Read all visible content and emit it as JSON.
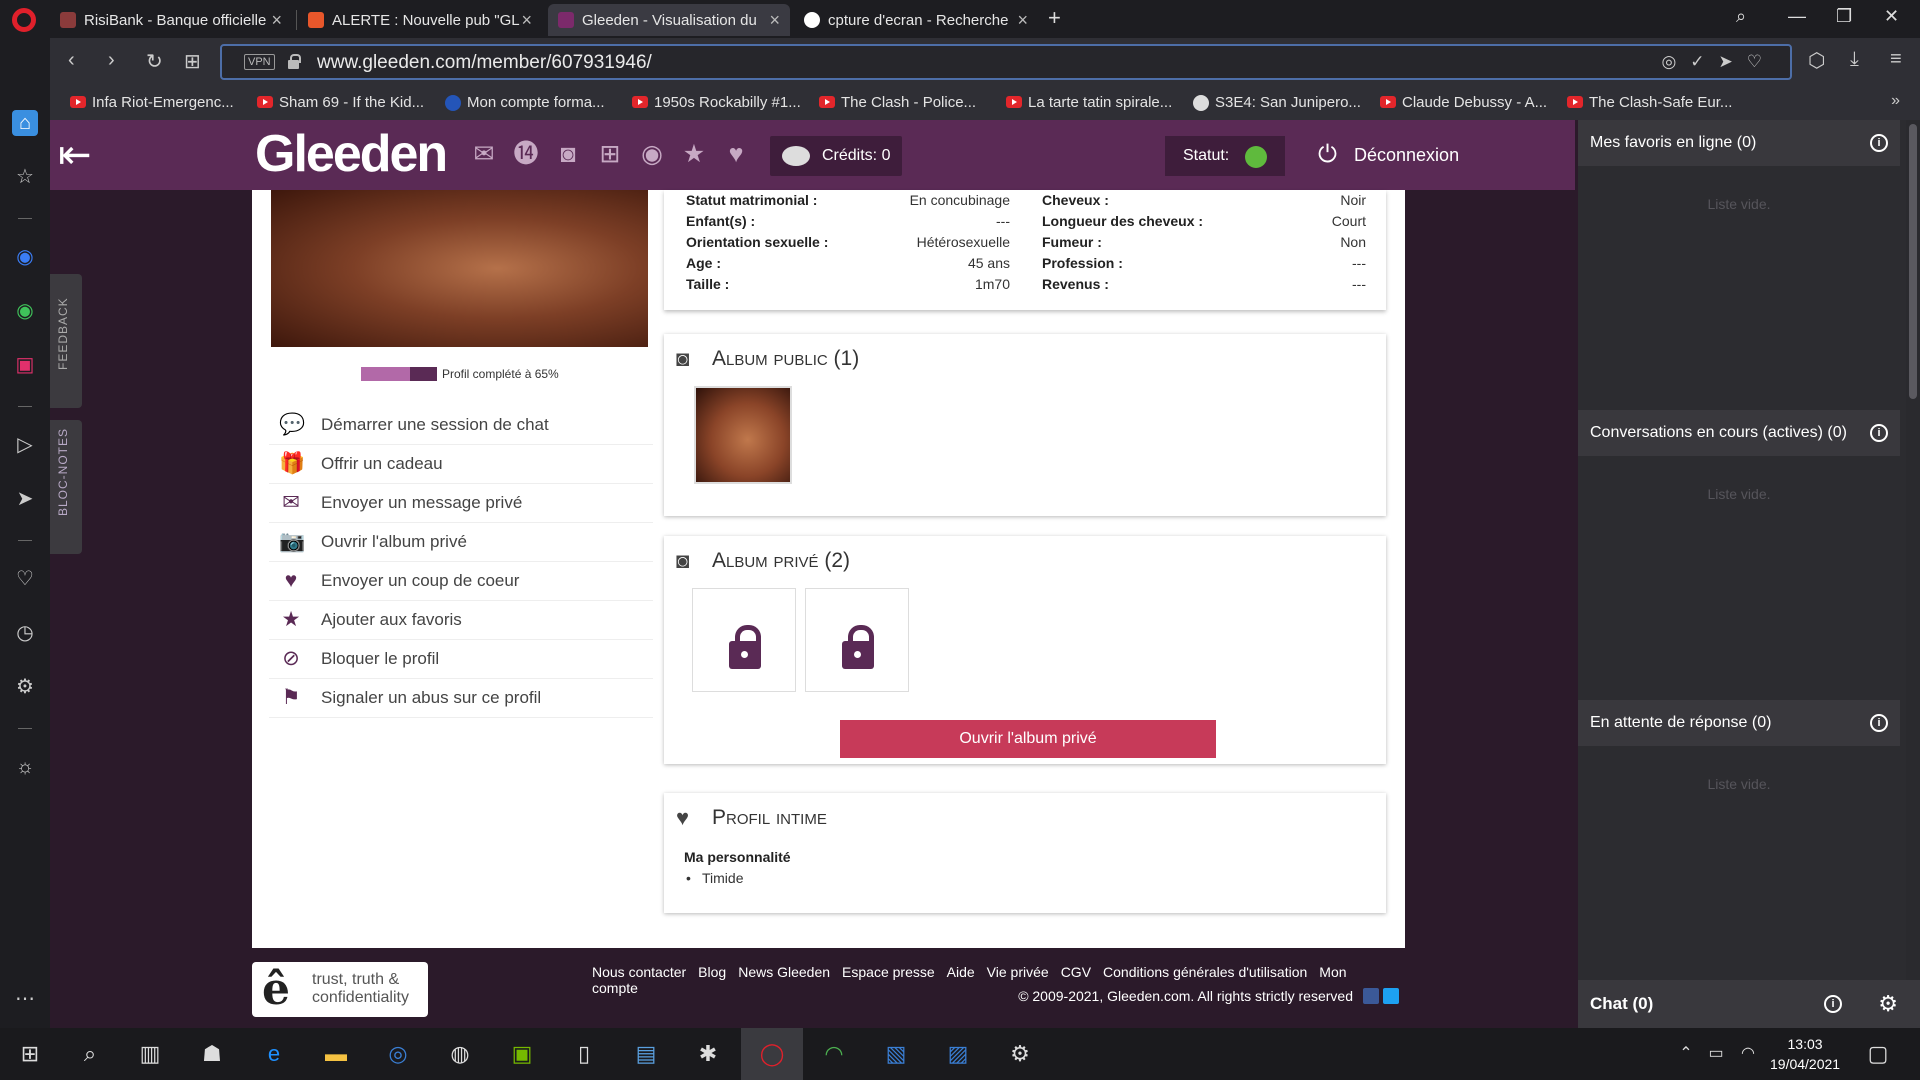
{
  "browser": {
    "tabs": [
      {
        "title": "RisiBank - Banque officielle",
        "color": "#8a3b3b"
      },
      {
        "title": "ALERTE : Nouvelle pub \"GL",
        "color": "#e8572b"
      },
      {
        "title": "Gleeden - Visualisation du",
        "color": "#7c2a6b",
        "active": true
      },
      {
        "title": "cpture d'ecran - Recherche",
        "color": "#ffffff"
      }
    ],
    "new_tab": "+",
    "url": "www.gleeden.com/member/607931946/",
    "vpn": "VPN",
    "bookmarks": [
      {
        "label": "Infa Riot-Emergenc...",
        "type": "youtube"
      },
      {
        "label": "Sham 69 - If the Kid...",
        "type": "youtube"
      },
      {
        "label": "Mon compte forma...",
        "type": "generic"
      },
      {
        "label": "1950s Rockabilly #1...",
        "type": "youtube"
      },
      {
        "label": "The Clash - Police...",
        "type": "youtube"
      },
      {
        "label": "La tarte tatin spirale...",
        "type": "youtube"
      },
      {
        "label": "S3E4: San Junipero...",
        "type": "generic"
      },
      {
        "label": "Claude Debussy - A...",
        "type": "youtube"
      },
      {
        "label": "The Clash-Safe Eur...",
        "type": "youtube"
      }
    ]
  },
  "side_tabs": {
    "feedback": "FEEDBACK",
    "notes": "BLOC-NOTES"
  },
  "header": {
    "brand": "Gleeden",
    "credits": "Crédits: 0",
    "statut": "Statut:",
    "status_color": "#5fba3d",
    "logout": "Déconnexion",
    "icons": [
      "mail-icon",
      "e-icon",
      "camera-icon",
      "gift-icon",
      "eye-icon",
      "star-icon",
      "heart-icon"
    ]
  },
  "profile": {
    "progress_label": "Profil complété à 65%",
    "progress_fraction": 0.65,
    "actions": [
      {
        "label": "Démarrer une session de chat",
        "icon": "chat-icon",
        "glyph": "💬"
      },
      {
        "label": "Offrir un cadeau",
        "icon": "gift-icon",
        "glyph": "🎁"
      },
      {
        "label": "Envoyer un message privé",
        "icon": "envelope-icon",
        "glyph": "✉"
      },
      {
        "label": "Ouvrir l'album privé",
        "icon": "camera-icon",
        "glyph": "📷"
      },
      {
        "label": "Envoyer un coup de coeur",
        "icon": "heart-icon",
        "glyph": "♥"
      },
      {
        "label": "Ajouter aux favoris",
        "icon": "star-icon",
        "glyph": "★"
      },
      {
        "label": "Bloquer le profil",
        "icon": "block-icon",
        "glyph": "⊘"
      },
      {
        "label": "Signaler un abus sur ce profil",
        "icon": "flag-icon",
        "glyph": "⚑"
      }
    ]
  },
  "info": {
    "left": [
      {
        "label": "Statut matrimonial :",
        "value": "En concubinage"
      },
      {
        "label": "Enfant(s) :",
        "value": "---"
      },
      {
        "label": "Orientation sexuelle :",
        "value": "Hétérosexuelle"
      },
      {
        "label": "Age :",
        "value": "45 ans"
      },
      {
        "label": "Taille :",
        "value": "1m70"
      }
    ],
    "right": [
      {
        "label": "Cheveux :",
        "value": "Noir"
      },
      {
        "label": "Longueur des cheveux :",
        "value": "Court"
      },
      {
        "label": "Fumeur :",
        "value": "Non"
      },
      {
        "label": "Profession :",
        "value": "---"
      },
      {
        "label": "Revenus :",
        "value": "---"
      }
    ]
  },
  "album_public": {
    "title": "Album public (1)"
  },
  "album_prive": {
    "title": "Album privé (2)",
    "button": "Ouvrir l'album privé",
    "locked_count": 2
  },
  "profil_intime": {
    "title": "Profil intime",
    "subtitle": "Ma personnalité",
    "items": [
      "Timide"
    ]
  },
  "footer": {
    "badge": "trust, truth & confidentiality",
    "links": [
      "Nous contacter",
      "Blog",
      "News Gleeden",
      "Espace presse",
      "Aide",
      "Vie privée",
      "CGV",
      "Conditions générales d'utilisation",
      "Mon compte"
    ],
    "copyright": "© 2009-2021, Gleeden.com. All rights strictly reserved"
  },
  "chat_panel": {
    "sections": [
      {
        "title": "Mes favoris en ligne (0)",
        "empty": "Liste vide."
      },
      {
        "title": "Conversations en cours (actives) (0)",
        "empty": "Liste vide."
      },
      {
        "title": "En attente de réponse (0)",
        "empty": "Liste vide."
      }
    ],
    "chat_label": "Chat (0)"
  },
  "taskbar": {
    "time": "13:03",
    "date": "19/04/2021"
  }
}
